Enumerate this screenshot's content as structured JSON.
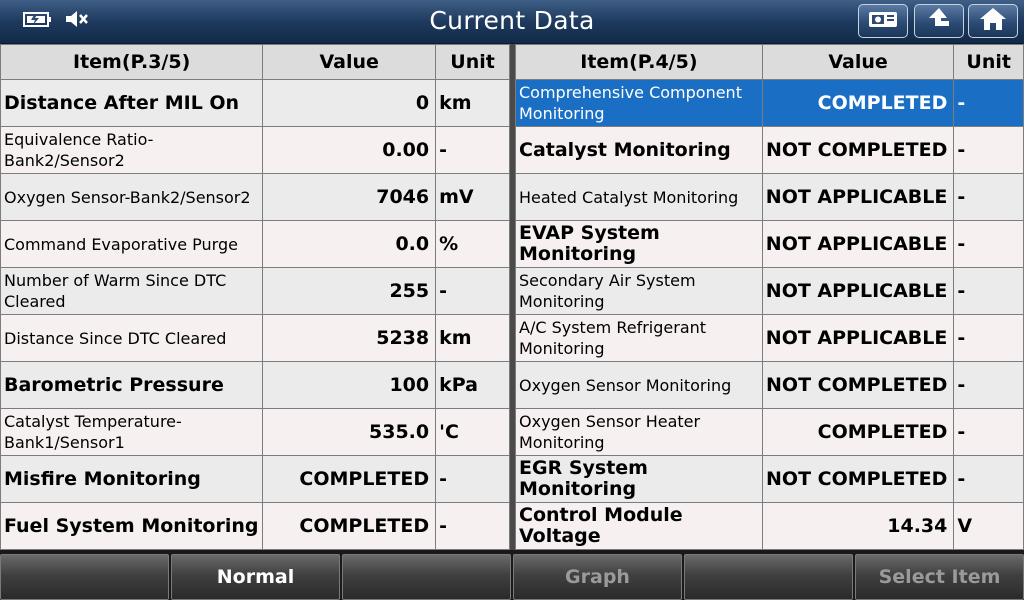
{
  "header": {
    "title": "Current Data",
    "icons": [
      "battery-icon",
      "mute-icon"
    ],
    "buttons": [
      "print-icon",
      "back-icon",
      "home-icon"
    ]
  },
  "left_table": {
    "headers": [
      "Item(P.3/5)",
      "Value",
      "Unit"
    ],
    "rows": [
      {
        "item": "Distance After MIL On",
        "value": "0",
        "unit": "km"
      },
      {
        "item": "Equivalence Ratio-Bank2/Sensor2",
        "value": "0.00",
        "unit": "-"
      },
      {
        "item": "Oxygen Sensor-Bank2/Sensor2",
        "value": "7046",
        "unit": "mV"
      },
      {
        "item": "Command Evaporative Purge",
        "value": "0.0",
        "unit": "%"
      },
      {
        "item": "Number of Warm Since DTC Cleared",
        "value": "255",
        "unit": "-"
      },
      {
        "item": "Distance Since DTC Cleared",
        "value": "5238",
        "unit": "km"
      },
      {
        "item": "Barometric Pressure",
        "value": "100",
        "unit": "kPa"
      },
      {
        "item": "Catalyst Temperature-Bank1/Sensor1",
        "value": "535.0",
        "unit": "'C"
      },
      {
        "item": "Misfire Monitoring",
        "value": "COMPLETED",
        "unit": "-"
      },
      {
        "item": "Fuel System Monitoring",
        "value": "COMPLETED",
        "unit": "-"
      }
    ]
  },
  "right_table": {
    "headers": [
      "Item(P.4/5)",
      "Value",
      "Unit"
    ],
    "rows": [
      {
        "item": "Comprehensive Component Monitoring",
        "value": "COMPLETED",
        "unit": "-"
      },
      {
        "item": "Catalyst Monitoring",
        "value": "NOT COMPLETED",
        "unit": "-"
      },
      {
        "item": "Heated Catalyst Monitoring",
        "value": "NOT APPLICABLE",
        "unit": "-"
      },
      {
        "item": "EVAP System Monitoring",
        "value": "NOT APPLICABLE",
        "unit": "-"
      },
      {
        "item": "Secondary Air System Monitoring",
        "value": "NOT APPLICABLE",
        "unit": "-"
      },
      {
        "item": "A/C System Refrigerant Monitoring",
        "value": "NOT APPLICABLE",
        "unit": "-"
      },
      {
        "item": "Oxygen Sensor Monitoring",
        "value": "NOT COMPLETED",
        "unit": "-"
      },
      {
        "item": "Oxygen Sensor Heater Monitoring",
        "value": "COMPLETED",
        "unit": "-"
      },
      {
        "item": "EGR System Monitoring",
        "value": "NOT COMPLETED",
        "unit": "-"
      },
      {
        "item": "Control Module Voltage",
        "value": "14.34",
        "unit": "V"
      }
    ]
  },
  "footer": {
    "buttons": [
      "",
      "Normal",
      "",
      "Graph",
      "",
      "Select Item"
    ]
  },
  "colors": {
    "selected_row": "#1a6fc4",
    "title_bar": "#1e3a5e"
  }
}
